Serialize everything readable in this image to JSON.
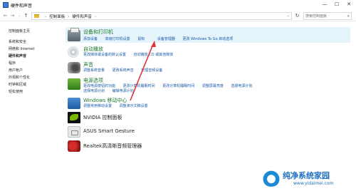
{
  "window": {
    "title": "硬件和声音",
    "minimize_glyph": "—",
    "maximize_glyph": "☐",
    "close_glyph": "✕"
  },
  "addressbar": {
    "back_glyph": "←",
    "forward_glyph": "→",
    "recent_glyph": "⌄",
    "up_glyph": "↑",
    "breadcrumbs": [
      "控制面板",
      "硬件和声音"
    ],
    "separator": "›",
    "refresh_glyph": "↻",
    "search_placeholder": "搜索控制面板",
    "search_glyph": "⌕"
  },
  "sidebar": {
    "items": [
      {
        "label": "控制面板主页",
        "current": false
      },
      {
        "label": "系统和安全",
        "current": false
      },
      {
        "label": "网络和 Internet",
        "current": false
      },
      {
        "label": "硬件和声音",
        "current": true
      },
      {
        "label": "程序",
        "current": false
      },
      {
        "label": "用户帐户",
        "current": false
      },
      {
        "label": "外观和个性化",
        "current": false
      },
      {
        "label": "时钟和区域",
        "current": false
      },
      {
        "label": "轻松使用",
        "current": false
      }
    ]
  },
  "categories": [
    {
      "icon": "devices-printers-icon",
      "title": "设备和打印机",
      "links_row1": [
        "添加设备",
        "高级打印机设置",
        "鼠标",
        "设备管理器",
        "更改 Windows To Go 启动选项"
      ],
      "links_row2": []
    },
    {
      "icon": "autoplay-icon",
      "title": "自动播放",
      "links_row1": [
        "更改媒体或设备的默认设置",
        "自动播放 CD 或其他媒体"
      ],
      "links_row2": []
    },
    {
      "icon": "sound-icon",
      "title": "声音",
      "links_row1": [
        "调整系统音量",
        "更改系统声音",
        "管理音频设备"
      ],
      "links_row2": []
    },
    {
      "icon": "power-options-icon",
      "title": "电源选项",
      "links_row1": [
        "更改电源按钮的功能",
        "更改计算机睡眠时间",
        "更改计算机睡眠时间",
        "调整屏幕亮度",
        "选择电源计划"
      ],
      "links_row2": [
        "选择电源计划",
        "编辑电源计划"
      ]
    },
    {
      "icon": "mobility-center-icon",
      "title": "Windows 移动中心",
      "links_row1": [
        "调整常用移动设置",
        "调整演示文稿设置"
      ],
      "links_row2": []
    },
    {
      "icon": "nvidia-icon",
      "title": "NVIDIA 控制面板",
      "links_row1": [],
      "links_row2": []
    },
    {
      "icon": "asus-gesture-icon",
      "title": "ASUS Smart Gesture",
      "links_row1": [],
      "links_row2": []
    },
    {
      "icon": "realtek-audio-icon",
      "title": "Realtek高清晰音频管理器",
      "links_row1": [],
      "links_row2": []
    }
  ],
  "watermark": {
    "title": "纯净系统家园",
    "url": "www.yidaimei.com"
  },
  "colors": {
    "link": "#1a5aa8",
    "category_title": "#1e7a2d",
    "highlight_row": "#e5f3fb",
    "annotation_arrow": "#e0343b"
  }
}
